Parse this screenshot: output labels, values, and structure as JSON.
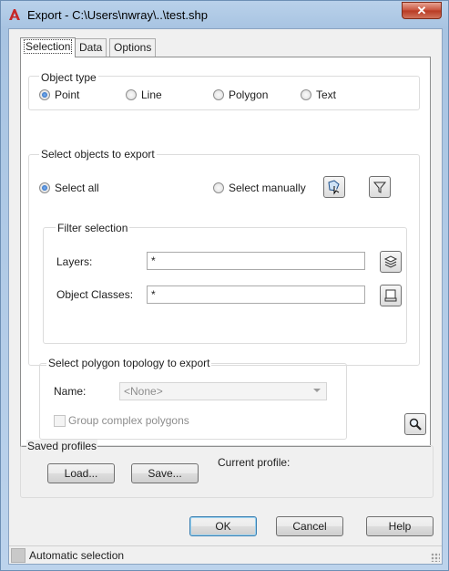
{
  "window": {
    "title": "Export - C:\\Users\\nwray\\..\\test.shp",
    "close_glyph": "✕",
    "app_icon": "autocad-a-icon"
  },
  "tabs": [
    {
      "label": "Selection",
      "active": true
    },
    {
      "label": "Data",
      "active": false
    },
    {
      "label": "Options",
      "active": false
    }
  ],
  "object_type": {
    "title": "Object type",
    "options": [
      {
        "label": "Point",
        "selected": true
      },
      {
        "label": "Line",
        "selected": false
      },
      {
        "label": "Polygon",
        "selected": false
      },
      {
        "label": "Text",
        "selected": false
      }
    ]
  },
  "select_objects": {
    "title": "Select objects to export",
    "select_all": "Select all",
    "select_manually": "Select manually",
    "mode": "select_all",
    "filter": {
      "title": "Filter selection",
      "layers_label": "Layers:",
      "layers_value": "*",
      "object_classes_label": "Object Classes:",
      "object_classes_value": "*"
    }
  },
  "topology": {
    "title": "Select polygon topology to export",
    "name_label": "Name:",
    "name_value": "<None>",
    "group_complex_label": "Group complex polygons",
    "group_complex_checked": false
  },
  "profiles": {
    "title": "Saved profiles",
    "load_label": "Load...",
    "save_label": "Save...",
    "current_label": "Current profile:"
  },
  "buttons": {
    "ok": "OK",
    "cancel": "Cancel",
    "help": "Help"
  },
  "status": {
    "text": "Automatic selection"
  },
  "colors": {
    "title_gradient": "#b9d1ea",
    "close_red": "#c7503a",
    "radio_fill": "#1c5fb9",
    "default_border": "#3c7fb1"
  }
}
